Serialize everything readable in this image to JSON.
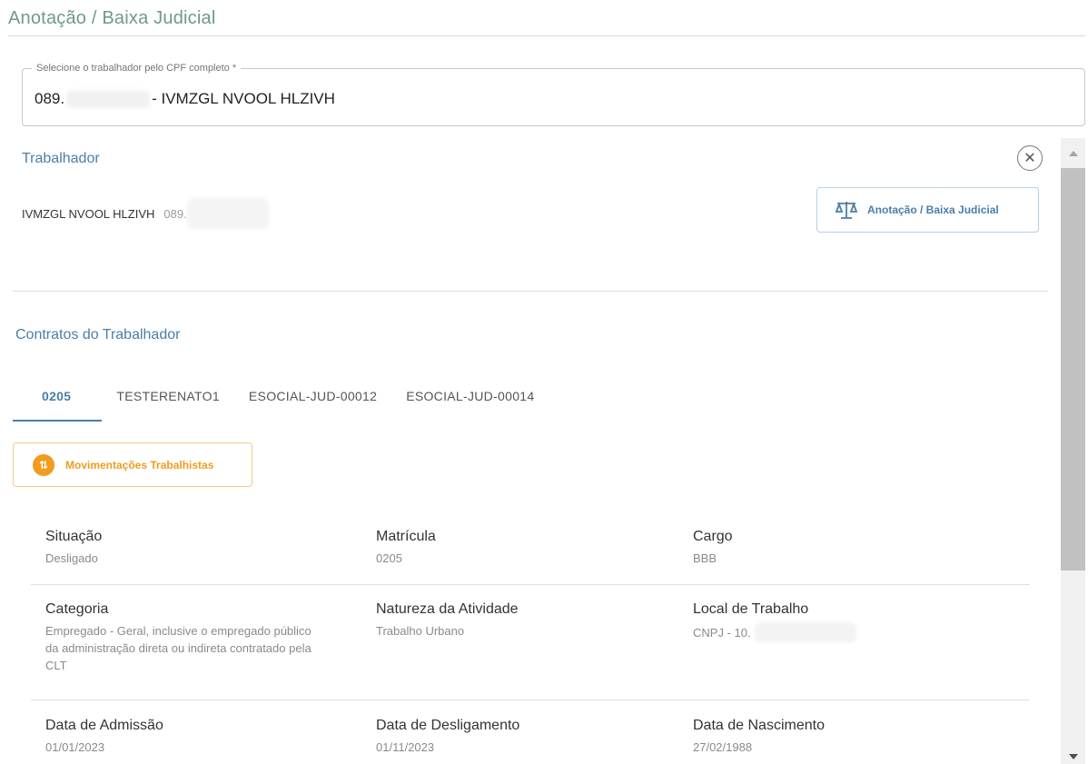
{
  "page": {
    "title": "Anotação / Baixa Judicial"
  },
  "search": {
    "legend": "Selecione o trabalhador pelo CPF completo *",
    "value_prefix": "089.",
    "value_suffix": "- IVMZGL NVOOL HLZIVH"
  },
  "worker": {
    "section_title": "Trabalhador",
    "name": "IVMZGL NVOOL HLZIVH",
    "cpf_prefix": "089.",
    "action_label": "Anotação / Baixa Judicial",
    "close_icon": "close-icon"
  },
  "contracts": {
    "section_title": "Contratos do Trabalhador",
    "tabs": [
      {
        "label": "0205",
        "active": true
      },
      {
        "label": "TESTERENATO1",
        "active": false
      },
      {
        "label": "ESOCIAL-JUD-00012",
        "active": false
      },
      {
        "label": "ESOCIAL-JUD-00014",
        "active": false
      }
    ],
    "movements_label": "Movimentações Trabalhistas",
    "fields": {
      "situacao": {
        "label": "Situação",
        "value": "Desligado"
      },
      "matricula": {
        "label": "Matrícula",
        "value": "0205"
      },
      "cargo": {
        "label": "Cargo",
        "value": "BBB"
      },
      "categoria": {
        "label": "Categoria",
        "value": "Empregado - Geral, inclusive o empregado público da administração direta ou indireta contratado pela CLT"
      },
      "natureza": {
        "label": "Natureza da Atividade",
        "value": "Trabalho Urbano"
      },
      "local": {
        "label": "Local de Trabalho",
        "value": "CNPJ - 10."
      },
      "admissao": {
        "label": "Data de Admissão",
        "value": "01/01/2023"
      },
      "desligamento": {
        "label": "Data de Desligamento",
        "value": "01/11/2023"
      },
      "nascimento": {
        "label": "Data de Nascimento",
        "value": "27/02/1988"
      }
    }
  },
  "colors": {
    "title_green": "#6e9a86",
    "accent_blue": "#4a7fa8",
    "orange": "#f19c1c"
  }
}
